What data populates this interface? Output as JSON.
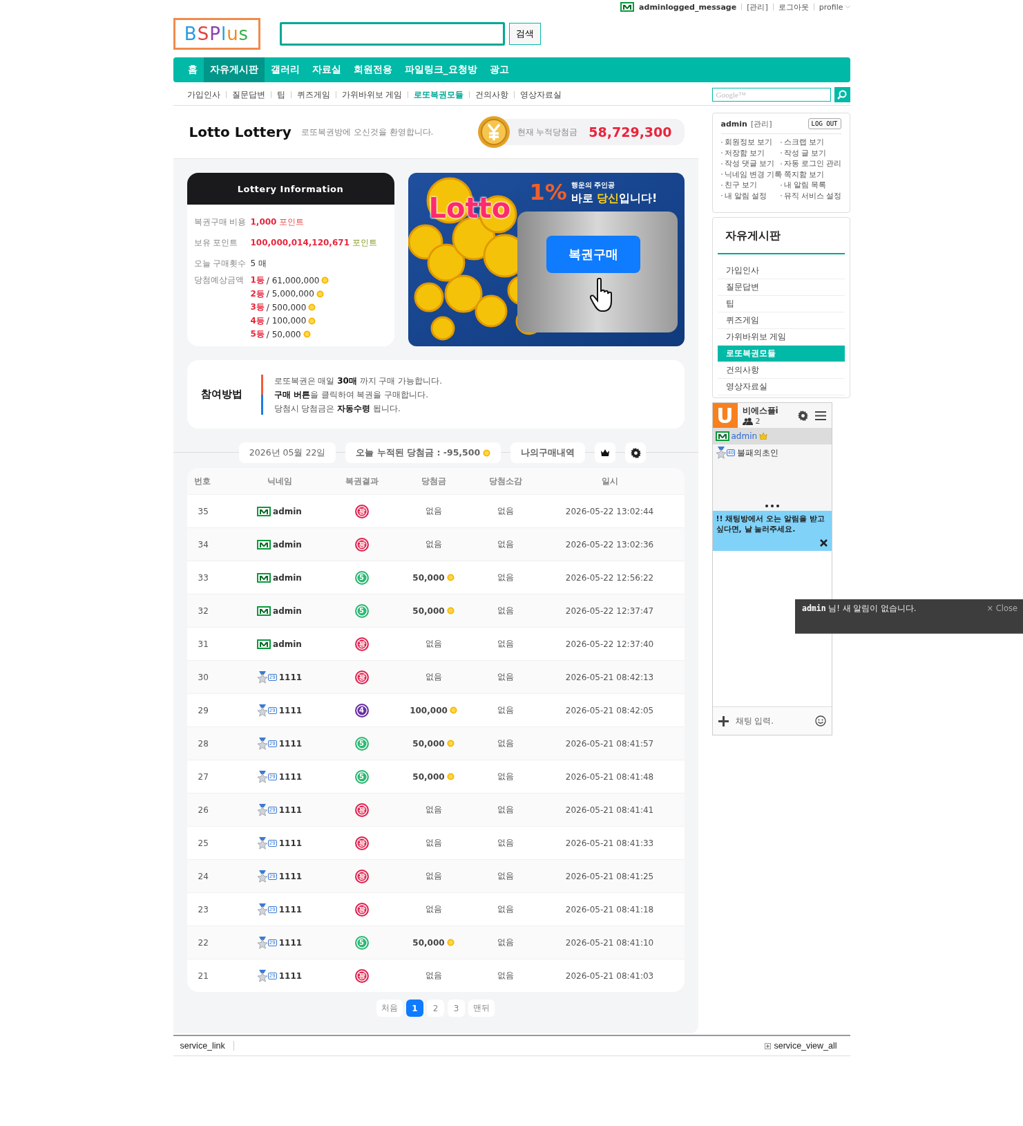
{
  "top_bar": {
    "user": "adminlogged_message",
    "links": [
      "[관리]",
      "로그아웃",
      "profile"
    ]
  },
  "logo": "BSPlus",
  "search": {
    "button": "검색"
  },
  "nav": [
    {
      "label": "홈",
      "selected": false
    },
    {
      "label": "자유게시판",
      "selected": true
    },
    {
      "label": "갤러리",
      "selected": false
    },
    {
      "label": "자료실",
      "selected": false
    },
    {
      "label": "회원전용",
      "selected": false
    },
    {
      "label": "파일링크_요청방",
      "selected": false
    },
    {
      "label": "광고",
      "selected": false
    }
  ],
  "subnav": [
    {
      "label": "가입인사",
      "selected": false
    },
    {
      "label": "질문답변",
      "selected": false
    },
    {
      "label": "팁",
      "selected": false
    },
    {
      "label": "퀴즈게임",
      "selected": false
    },
    {
      "label": "가위바위보 게임",
      "selected": false
    },
    {
      "label": "로또복권모듈",
      "selected": true
    },
    {
      "label": "건의사항",
      "selected": false
    },
    {
      "label": "영상자료실",
      "selected": false
    }
  ],
  "google_search": {
    "placeholder": "Google™"
  },
  "page_header": {
    "title": "Lotto Lottery",
    "subtitle": "로또복권방에 오신것을 환영합니다.",
    "jackpot_label": "현재 누적당첨금",
    "jackpot": "58,729,300"
  },
  "info_card": {
    "title": "Lottery Information",
    "rows": [
      {
        "kind": "cost",
        "label": "복권구매 비용",
        "value": "1,000",
        "unit": "포인트"
      },
      {
        "kind": "balance",
        "label": "보유 포인트",
        "value": "100,000,014,120,671",
        "unit": "포인트"
      },
      {
        "kind": "count",
        "label": "오늘 구매횟수",
        "value": "5 매"
      }
    ],
    "prize_label": "당첨예상금액",
    "prizes": [
      {
        "rank": "1등",
        "amount": "/ 61,000,000"
      },
      {
        "rank": "2등",
        "amount": "/ 5,000,000"
      },
      {
        "rank": "3등",
        "amount": "/ 500,000"
      },
      {
        "rank": "4등",
        "amount": "/ 100,000"
      },
      {
        "rank": "5등",
        "amount": "/ 50,000"
      }
    ]
  },
  "banner": {
    "logo": "Lotto",
    "percent": "1%",
    "tagline": "행운의 주인공",
    "headline": "바로 **당신**입니다!",
    "button": "복권구매"
  },
  "howto": {
    "title": "참여방법",
    "lines": [
      "로또복권은 매일 **30매** 까지 구매 가능합니다.",
      "**구매 버튼**을 클릭하여 복권을 구매합니다.",
      "당첨시 당첨금은 **자동수령** 됩니다."
    ]
  },
  "toolbar": {
    "date": "2026년 05월 22일",
    "today_total": "오늘 누적된 당첨금 : -95,500",
    "history_button": "나의구매내역"
  },
  "table": {
    "columns": [
      "번호",
      "닉네임",
      "복권결과",
      "당첨금",
      "당첨소감",
      "일시"
    ],
    "rows": [
      {
        "no": "35",
        "user": {
          "kind": "admin",
          "name": "admin"
        },
        "result": {
          "label": "꽝",
          "color": "#e2234f"
        },
        "prize": {
          "kind": "none",
          "text": "없음"
        },
        "comment": "없음",
        "datetime": "2026-05-22 13:02:44"
      },
      {
        "no": "34",
        "user": {
          "kind": "admin",
          "name": "admin"
        },
        "result": {
          "label": "꽝",
          "color": "#e2234f"
        },
        "prize": {
          "kind": "none",
          "text": "없음"
        },
        "comment": "없음",
        "datetime": "2026-05-22 13:02:36"
      },
      {
        "no": "33",
        "user": {
          "kind": "admin",
          "name": "admin"
        },
        "result": {
          "label": "5",
          "color": "#2db874"
        },
        "prize": {
          "kind": "points",
          "text": "50,000"
        },
        "comment": "없음",
        "datetime": "2026-05-22 12:56:22"
      },
      {
        "no": "32",
        "user": {
          "kind": "admin",
          "name": "admin"
        },
        "result": {
          "label": "5",
          "color": "#2db874"
        },
        "prize": {
          "kind": "points",
          "text": "50,000"
        },
        "comment": "없음",
        "datetime": "2026-05-22 12:37:47"
      },
      {
        "no": "31",
        "user": {
          "kind": "admin",
          "name": "admin"
        },
        "result": {
          "label": "꽝",
          "color": "#e2234f"
        },
        "prize": {
          "kind": "none",
          "text": "없음"
        },
        "comment": "없음",
        "datetime": "2026-05-22 12:37:40"
      },
      {
        "no": "30",
        "user": {
          "kind": "member",
          "level": "29",
          "name": "1111"
        },
        "result": {
          "label": "꽝",
          "color": "#e2234f"
        },
        "prize": {
          "kind": "none",
          "text": "없음"
        },
        "comment": "없음",
        "datetime": "2026-05-21 08:42:13"
      },
      {
        "no": "29",
        "user": {
          "kind": "member",
          "level": "29",
          "name": "1111"
        },
        "result": {
          "label": "4",
          "color": "#6a2fa3"
        },
        "prize": {
          "kind": "points",
          "text": "100,000"
        },
        "comment": "없음",
        "datetime": "2026-05-21 08:42:05"
      },
      {
        "no": "28",
        "user": {
          "kind": "member",
          "level": "29",
          "name": "1111"
        },
        "result": {
          "label": "5",
          "color": "#2db874"
        },
        "prize": {
          "kind": "points",
          "text": "50,000"
        },
        "comment": "없음",
        "datetime": "2026-05-21 08:41:57"
      },
      {
        "no": "27",
        "user": {
          "kind": "member",
          "level": "29",
          "name": "1111"
        },
        "result": {
          "label": "5",
          "color": "#2db874"
        },
        "prize": {
          "kind": "points",
          "text": "50,000"
        },
        "comment": "없음",
        "datetime": "2026-05-21 08:41:48"
      },
      {
        "no": "26",
        "user": {
          "kind": "member",
          "level": "29",
          "name": "1111"
        },
        "result": {
          "label": "꽝",
          "color": "#e2234f"
        },
        "prize": {
          "kind": "none",
          "text": "없음"
        },
        "comment": "없음",
        "datetime": "2026-05-21 08:41:41"
      },
      {
        "no": "25",
        "user": {
          "kind": "member",
          "level": "29",
          "name": "1111"
        },
        "result": {
          "label": "꽝",
          "color": "#e2234f"
        },
        "prize": {
          "kind": "none",
          "text": "없음"
        },
        "comment": "없음",
        "datetime": "2026-05-21 08:41:33"
      },
      {
        "no": "24",
        "user": {
          "kind": "member",
          "level": "29",
          "name": "1111"
        },
        "result": {
          "label": "꽝",
          "color": "#e2234f"
        },
        "prize": {
          "kind": "none",
          "text": "없음"
        },
        "comment": "없음",
        "datetime": "2026-05-21 08:41:25"
      },
      {
        "no": "23",
        "user": {
          "kind": "member",
          "level": "29",
          "name": "1111"
        },
        "result": {
          "label": "꽝",
          "color": "#e2234f"
        },
        "prize": {
          "kind": "none",
          "text": "없음"
        },
        "comment": "없음",
        "datetime": "2026-05-21 08:41:18"
      },
      {
        "no": "22",
        "user": {
          "kind": "member",
          "level": "29",
          "name": "1111"
        },
        "result": {
          "label": "5",
          "color": "#2db874"
        },
        "prize": {
          "kind": "points",
          "text": "50,000"
        },
        "comment": "없음",
        "datetime": "2026-05-21 08:41:10"
      },
      {
        "no": "21",
        "user": {
          "kind": "member",
          "level": "29",
          "name": "1111"
        },
        "result": {
          "label": "꽝",
          "color": "#e2234f"
        },
        "prize": {
          "kind": "none",
          "text": "없음"
        },
        "comment": "없음",
        "datetime": "2026-05-21 08:41:03"
      }
    ]
  },
  "pagination": {
    "first": "처음",
    "pages": [
      {
        "label": "1",
        "selected": true
      },
      {
        "label": "2",
        "selected": false
      },
      {
        "label": "3",
        "selected": false
      }
    ],
    "last": "맨뒤"
  },
  "footer": {
    "left": "service_link",
    "right": "service_view_all"
  },
  "sidebar": {
    "login": {
      "user": "admin",
      "admin_link": "[관리]",
      "logout": "LOG OUT",
      "links": [
        "회원정보 보기",
        "스크랩 보기",
        "저장함 보기",
        "작성 글 보기",
        "작성 댓글 보기",
        "자동 로그인 관리",
        "닉네임 변경 기록",
        "쪽지함 보기",
        "친구 보기",
        "내 알림 목록",
        "내 알림 설정",
        "뮤직 서비스 설정"
      ]
    },
    "board": {
      "title": "자유게시판",
      "items": [
        {
          "label": "가입인사",
          "selected": false
        },
        {
          "label": "질문답변",
          "selected": false
        },
        {
          "label": "팁",
          "selected": false
        },
        {
          "label": "퀴즈게임",
          "selected": false
        },
        {
          "label": "가위바위보 게임",
          "selected": false
        },
        {
          "label": "로또복권모듈",
          "selected": true
        },
        {
          "label": "건의사항",
          "selected": false
        },
        {
          "label": "영상자료실",
          "selected": false
        }
      ]
    },
    "chat": {
      "logo": "U",
      "room": "비에스플i",
      "users": "2",
      "members": [
        {
          "kind": "admin",
          "name": "admin",
          "selected": true
        },
        {
          "kind": "member",
          "level": "40",
          "name": "불패의초인",
          "selected": false
        }
      ],
      "notice": "!! 채팅방에서 오는 알림을 받고싶다면, 날 눌러주세요.",
      "placeholder": "채팅 입력."
    }
  },
  "toast": {
    "message": "**admin** 님!  새 알림이 없습니다.",
    "close": "× Close"
  }
}
